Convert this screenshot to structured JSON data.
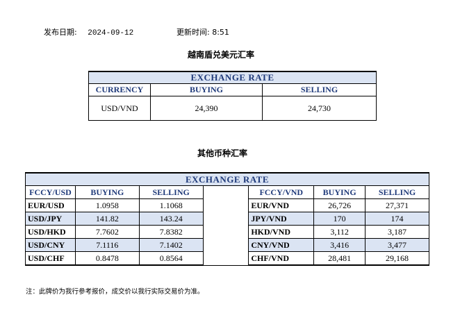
{
  "header": {
    "date_label": "发布日期:",
    "date_value": "2024-09-12",
    "time_label": "更新时间:",
    "time_value": "8:51"
  },
  "usd_section": {
    "title": "越南盾兑美元汇率",
    "bar": "EXCHANGE RATE",
    "columns": [
      "CURRENCY",
      "BUYING",
      "SELLING"
    ],
    "row": {
      "currency": "USD/VND",
      "buying": "24,390",
      "selling": "24,730"
    }
  },
  "other_section": {
    "title": "其他币种汇率",
    "bar": "EXCHANGE  RATE",
    "left_columns": [
      "FCCY/USD",
      "BUYING",
      "SELLING"
    ],
    "right_columns": [
      "FCCY/VND",
      "BUYING",
      "SELLING"
    ],
    "rows": [
      {
        "l_pair": "EUR/USD",
        "l_buy": "1.0958",
        "l_sell": "1.1068",
        "r_pair": "EUR/VND",
        "r_buy": "26,726",
        "r_sell": "27,371"
      },
      {
        "l_pair": "USD/JPY",
        "l_buy": "141.82",
        "l_sell": "143.24",
        "r_pair": "JPY/VND",
        "r_buy": "170",
        "r_sell": "174"
      },
      {
        "l_pair": "USD/HKD",
        "l_buy": "7.7602",
        "l_sell": "7.8382",
        "r_pair": "HKD/VND",
        "r_buy": "3,112",
        "r_sell": "3,187"
      },
      {
        "l_pair": "USD/CNY",
        "l_buy": "7.1116",
        "l_sell": "7.1402",
        "r_pair": "CNY/VND",
        "r_buy": "3,416",
        "r_sell": "3,477"
      },
      {
        "l_pair": "USD/CHF",
        "l_buy": "0.8478",
        "l_sell": "0.8564",
        "r_pair": "CHF/VND",
        "r_buy": "28,481",
        "r_sell": "29,168"
      }
    ]
  },
  "footer_note": "注：此牌价为我行参考报价，成交价以我行实际交易价为准。",
  "colors": {
    "header_fill": "#dbe4f3",
    "header_text": "#1f3a7a"
  }
}
